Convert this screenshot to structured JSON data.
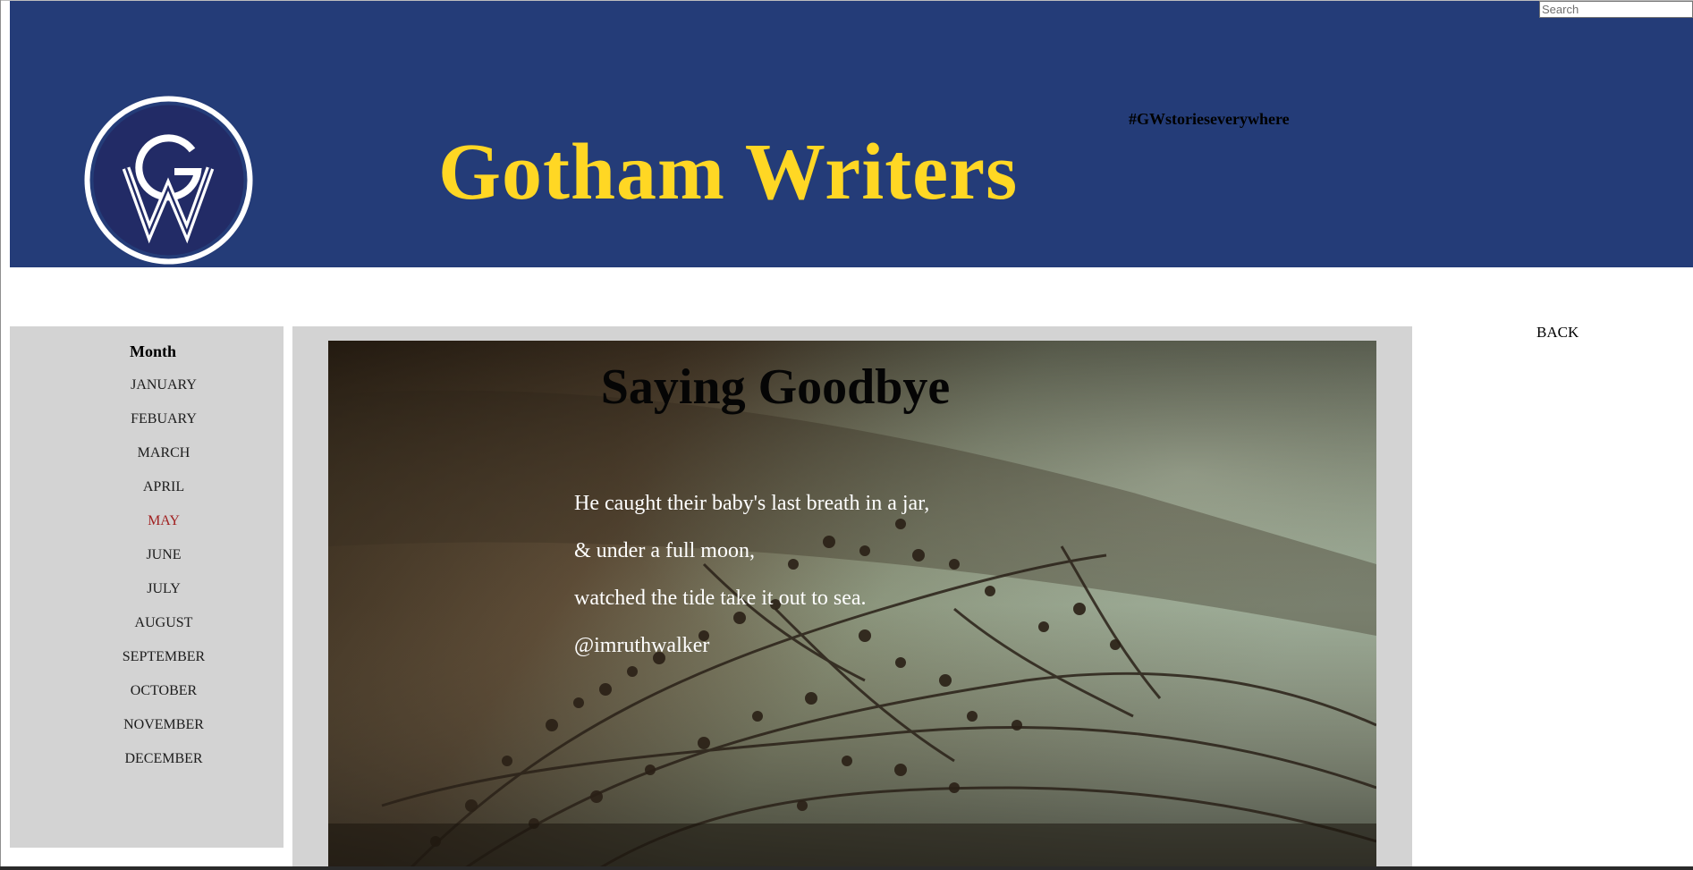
{
  "header": {
    "logo_alt": "GW logo",
    "title": "Gotham Writers",
    "hashtag": "#GWstorieseverywhere",
    "search_placeholder": "Search",
    "search_value": ""
  },
  "nav": {
    "back_label": "BACK"
  },
  "sidebar": {
    "heading": "Month",
    "months": [
      {
        "label": "JANUARY",
        "active": false
      },
      {
        "label": "FEBUARY",
        "active": false
      },
      {
        "label": "MARCH",
        "active": false
      },
      {
        "label": "APRIL",
        "active": false
      },
      {
        "label": "MAY",
        "active": true
      },
      {
        "label": "JUNE",
        "active": false
      },
      {
        "label": "JULY",
        "active": false
      },
      {
        "label": "AUGUST",
        "active": false
      },
      {
        "label": "SEPTEMBER",
        "active": false
      },
      {
        "label": "OCTOBER",
        "active": false
      },
      {
        "label": "NOVEMBER",
        "active": false
      },
      {
        "label": "DECEMBER",
        "active": false
      }
    ]
  },
  "post": {
    "title": "Saying Goodbye",
    "lines": [
      "He caught their baby's last breath in a jar,",
      "& under a full moon,",
      "watched the tide take it out to sea.",
      "@imruthwalker"
    ]
  },
  "colors": {
    "header_bg": "#243c78",
    "title_yellow": "#ffd724",
    "panel_gray": "#d3d3d3",
    "active_month": "#a12222"
  },
  "icons": {
    "logo": "gw-monogram-logo"
  }
}
